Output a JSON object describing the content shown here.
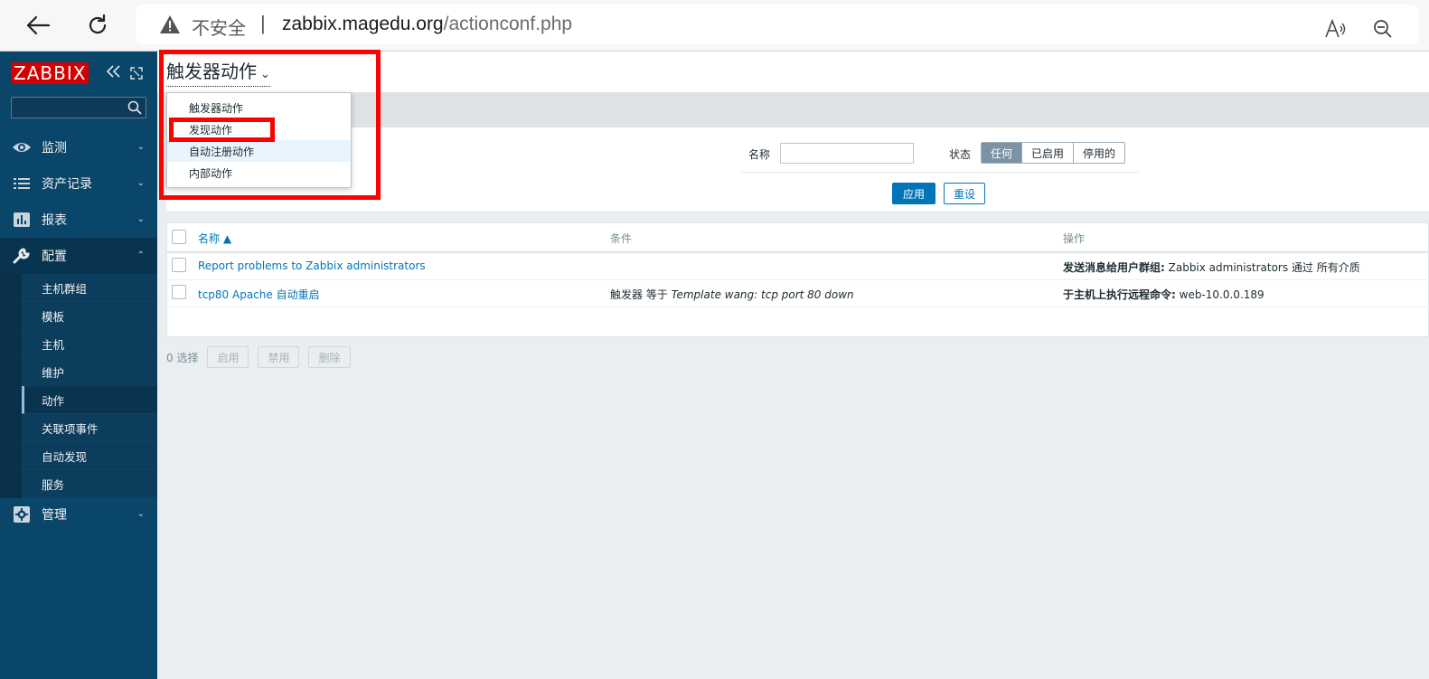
{
  "browser": {
    "insecure_label": "不安全",
    "separator": "|",
    "url_host": "zabbix.magedu.org",
    "url_path": "/actionconf.php"
  },
  "sidebar": {
    "logo": "ZABBIX",
    "menu": [
      {
        "label": "监测",
        "icon": "eye-icon"
      },
      {
        "label": "资产记录",
        "icon": "list-icon"
      },
      {
        "label": "报表",
        "icon": "bar-chart-icon"
      },
      {
        "label": "配置",
        "icon": "wrench-icon"
      },
      {
        "label": "管理",
        "icon": "gear-icon"
      }
    ],
    "config_submenu": [
      "主机群组",
      "模板",
      "主机",
      "维护",
      "动作",
      "关联项事件",
      "自动发现",
      "服务"
    ],
    "selected_submenu": "动作"
  },
  "page": {
    "title": "触发器动作"
  },
  "dropdown": {
    "items": [
      "触发器动作",
      "发现动作",
      "自动注册动作",
      "内部动作"
    ]
  },
  "filter": {
    "name_label": "名称",
    "name_value": "",
    "status_label": "状态",
    "status_options": [
      "任何",
      "已启用",
      "停用的"
    ],
    "status_selected": "任何",
    "apply_label": "应用",
    "reset_label": "重设"
  },
  "table": {
    "headers": {
      "name": "名称 ▲",
      "conditions": "条件",
      "operations": "操作"
    },
    "rows": [
      {
        "name": "Report problems to Zabbix administrators",
        "condition_prefix": "",
        "condition_italic": "",
        "operation_bold": "发送消息给用户群组:",
        "operation_rest": " Zabbix administrators 通过 所有介质"
      },
      {
        "name": "tcp80 Apache 自动重启",
        "condition_prefix": "触发器 等于 ",
        "condition_italic": "Template wang: tcp port 80 down",
        "operation_bold": "于主机上执行远程命令:",
        "operation_rest": " web-10.0.0.189"
      }
    ]
  },
  "footer": {
    "selected_count": "0 选择",
    "buttons": [
      "启用",
      "禁用",
      "删除"
    ]
  },
  "colors": {
    "sidebar_bg": "#0a466a",
    "accent": "#0275b8",
    "annotation": "#ff0000",
    "logo_bg": "#d40000"
  }
}
